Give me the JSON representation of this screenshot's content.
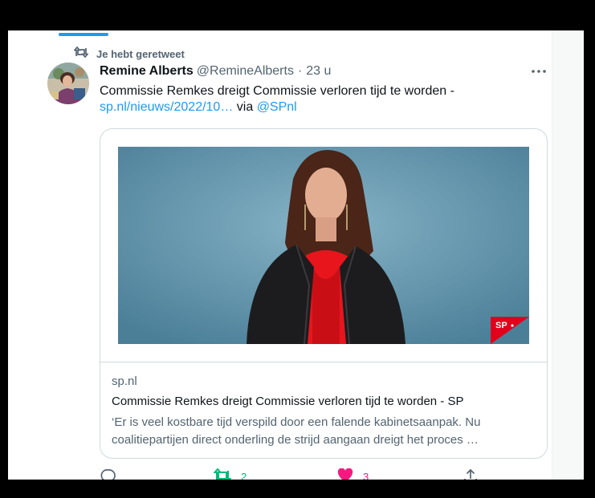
{
  "retweet_context": {
    "label": "Je hebt geretweet"
  },
  "tweet": {
    "author_name": "Remine Alberts",
    "handle": "@RemineAlberts",
    "separator": "·",
    "time": "23 u",
    "text_main": "Commissie Remkes dreigt Commissie verloren tijd te worden -",
    "link_text": "sp.nl/nieuws/2022/10…",
    "via_text": "via",
    "mention": "@SPnl"
  },
  "card": {
    "domain": "sp.nl",
    "title": "Commissie Remkes dreigt Commissie verloren tijd te worden - SP",
    "description": "‘Er is veel kostbare tijd verspild door een falende kabinetsaanpak. Nu coalitiepartijen direct onderling de strijd aangaan dreigt het proces …",
    "logo_text": "SP"
  },
  "actions": {
    "retweet_count": "2",
    "like_count": "3"
  },
  "colors": {
    "accent": "#1d9bf0",
    "retweet_active": "#00ba7c",
    "like_active": "#f91880",
    "sp_red": "#e3001b"
  }
}
